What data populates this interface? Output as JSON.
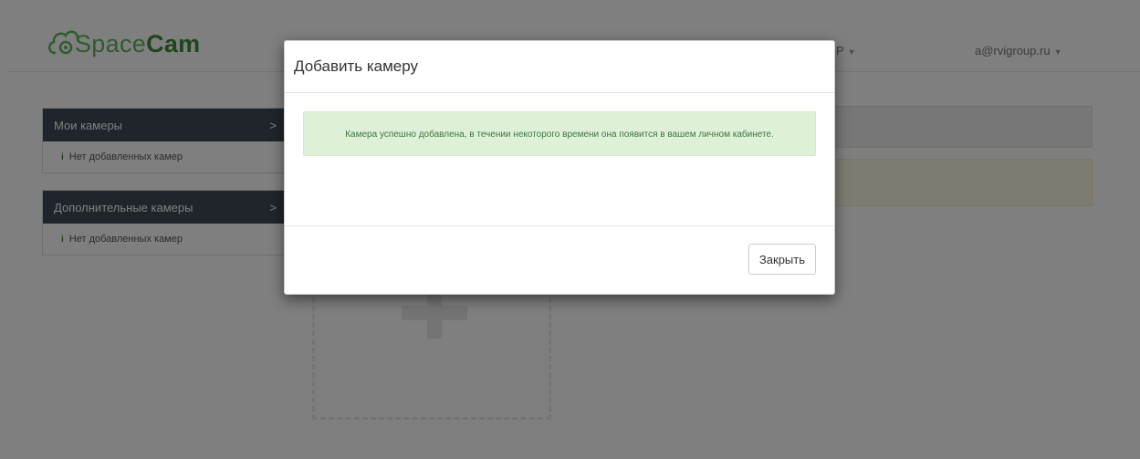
{
  "header": {
    "logo_text_light": "Space",
    "logo_text_bold": "Cam",
    "nav_truncated": "P",
    "user_email": "a@rvigroup.ru"
  },
  "sidebar": {
    "panels": [
      {
        "title": "Мои камеры",
        "chevron": ">",
        "empty_text": "Нет добавленных камер"
      },
      {
        "title": "Дополнительные камеры",
        "chevron": ">",
        "empty_text": "Нет добавленных камер"
      }
    ]
  },
  "modal": {
    "title": "Добавить камеру",
    "message": "Камера успешно добавлена, в течении некоторого времени она появится в вашем личном кабинете.",
    "close_label": "Закрыть"
  },
  "icons": {
    "logo": "camera-cloud-logo",
    "info": "info-icon",
    "dropdown": "caret-down-icon",
    "add": "plus-icon"
  },
  "colors": {
    "brand_green": "#5cb85c",
    "panel_header": "#3f4a55",
    "success_bg": "#dff0d8",
    "success_text": "#3c763d",
    "overlay": "rgba(0,0,0,0.5)"
  }
}
